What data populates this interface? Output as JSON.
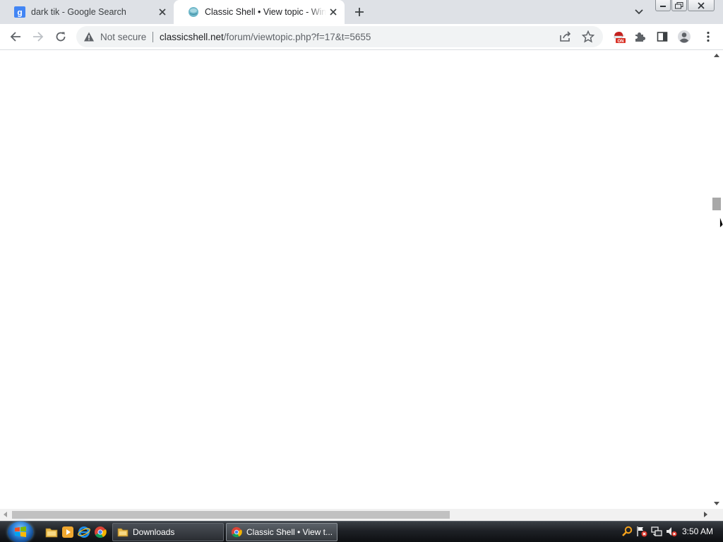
{
  "browser": {
    "tabs": [
      {
        "title": "dark tik - Google Search",
        "favicon": "google-g-icon",
        "active": false
      },
      {
        "title": "Classic Shell • View topic - Windows",
        "favicon": "globe-icon",
        "active": true
      }
    ],
    "toolbar": {
      "security_label": "Not secure",
      "url_host": "classicshell.net",
      "url_path": "/forum/viewtopic.php?f=17&t=5655",
      "extension_badge": "ON"
    }
  },
  "taskbar": {
    "tasks": [
      {
        "label": "Downloads",
        "icon": "folder-icon"
      },
      {
        "label": "Classic Shell • View t...",
        "icon": "chrome-icon"
      }
    ],
    "clock": "3:50 AM"
  },
  "colors": {
    "tabstrip": "#dee1e6",
    "omnibox": "#f1f3f4",
    "taskbar": "#1e2126",
    "extension_badge": "#d93025"
  }
}
